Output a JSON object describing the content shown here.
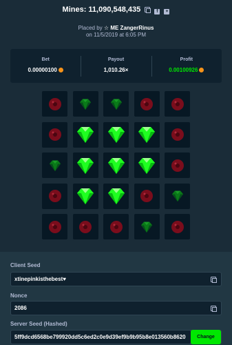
{
  "header": {
    "title": "Mines: 11,090,548,435",
    "copy_icon": "copy-icon",
    "facebook_icon": "facebook-icon",
    "twitter_icon": "twitter-icon"
  },
  "placed": {
    "prefix": "Placed by",
    "user_icon": "star-icon",
    "username": "ME ZangerRinus",
    "date_line": "on 11/5/2019 at 6:05 PM"
  },
  "stats": {
    "bet_label": "Bet",
    "bet_value": "0.00000100",
    "payout_label": "Payout",
    "payout_value": "1,010.26×",
    "profit_label": "Profit",
    "profit_value": "0.00100926",
    "currency_icon": "bitcoin-icon"
  },
  "board": {
    "rows": [
      [
        "mine",
        "gem-dim",
        "gem-dim",
        "mine",
        "mine"
      ],
      [
        "mine",
        "gem",
        "gem",
        "gem",
        "mine"
      ],
      [
        "gem-dim",
        "gem",
        "gem",
        "gem",
        "mine"
      ],
      [
        "mine",
        "gem",
        "gem",
        "mine",
        "gem-dim"
      ],
      [
        "mine",
        "mine",
        "mine",
        "gem-dim",
        "mine"
      ]
    ]
  },
  "fields": {
    "client_seed_label": "Client Seed",
    "client_seed_value": "xtinepinkisthebest♥",
    "nonce_label": "Nonce",
    "nonce_value": "2086",
    "server_seed_label": "Server Seed (Hashed)",
    "server_seed_value": "5ff9dcd6568be799920dd5c6ed2c0e9d39ef9b9b95b8e013560b8620",
    "change_label": "Change"
  },
  "colors": {
    "background": "#1a2c38",
    "panel": "#0f212e",
    "accent_green": "#00e701",
    "gem": "#1fff20",
    "mine": "#7a0d1c"
  }
}
